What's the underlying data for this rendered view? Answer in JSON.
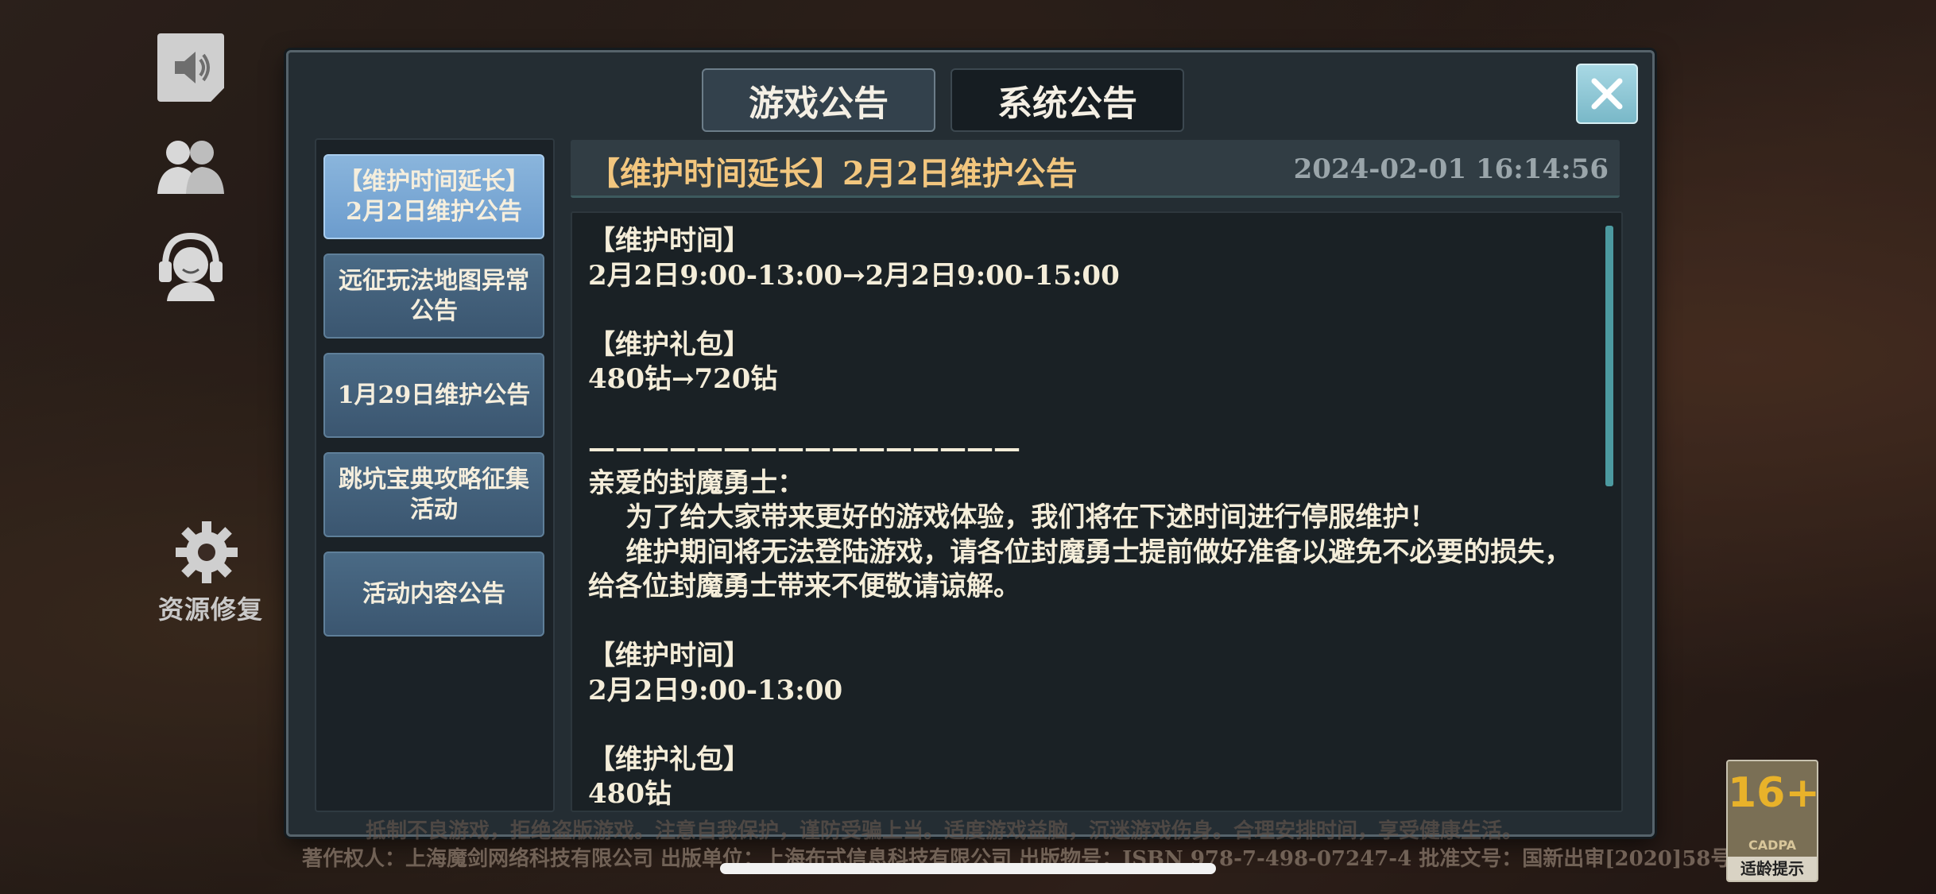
{
  "tabs": {
    "game": "游戏公告",
    "system": "系统公告"
  },
  "sidebar": {
    "repair_label": "资源修复"
  },
  "announcement_list": [
    {
      "label": "【维护时间延长】2月2日维护公告",
      "active": true
    },
    {
      "label": "远征玩法地图异常公告",
      "active": false
    },
    {
      "label": "1月29日维护公告",
      "active": false
    },
    {
      "label": "跳坑宝典攻略征集活动",
      "active": false
    },
    {
      "label": "活动内容公告",
      "active": false
    }
  ],
  "announcement": {
    "title": "【维护时间延长】2月2日维护公告",
    "timestamp": "2024-02-01  16:14:56",
    "body": "【维护时间】\n2月2日9:00-13:00→2月2日9:00-15:00\n\n【维护礼包】\n480钻→720钻\n\n————————————————\n亲爱的封魔勇士：\n    为了给大家带来更好的游戏体验，我们将在下述时间进行停服维护！\n    维护期间将无法登陆游戏，请各位封魔勇士提前做好准备以避免不必要的损失，给各位封魔勇士带来不便敬请谅解。\n\n【维护时间】\n2月2日9:00-13:00\n\n【维护礼包】\n480钻"
  },
  "footer": {
    "health_notice": "抵制不良游戏，拒绝盗版游戏。注意自我保护，谨防受骗上当。适度游戏益脑，沉迷游戏伤身。合理安排时间，享受健康生活。",
    "copyright": "著作权人：上海魔剑网络科技有限公司 出版单位：上海布式信息科技有限公司 出版物号：ISBN 978-7-498-07247-4 批准文号：国新出审[2020]58号"
  },
  "age_rating": {
    "number": "16+",
    "org": "CADPA",
    "label": "适龄提示"
  },
  "colors": {
    "title_gold": "#f2c67e",
    "active_item": "#7aa7d4",
    "close_button": "#8cc6d4",
    "scrollbar": "#4c9aa0"
  }
}
